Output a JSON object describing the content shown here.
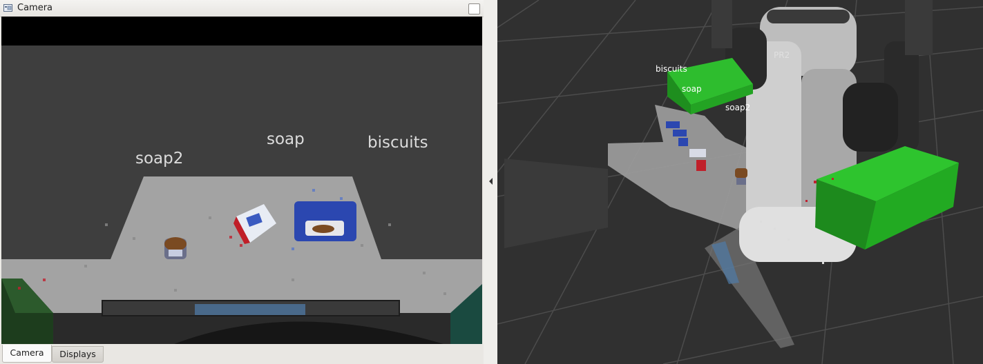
{
  "camera_panel": {
    "title": "Camera",
    "labels": {
      "soap2": "soap2",
      "soap": "soap",
      "biscuits": "biscuits"
    }
  },
  "tabs": {
    "camera": "Camera",
    "displays": "Displays"
  },
  "scene_view": {
    "robot_label": "PR2",
    "labels": {
      "biscuits": "biscuits",
      "soap": "soap",
      "soap2": "soap2"
    }
  },
  "colors": {
    "scene_background": "#303030",
    "grid": "#4a4a4a",
    "table": "#9a9a9a",
    "bin_green": "#2fbf2f",
    "soap_red": "#c0202a",
    "biscuits_blue": "#2b47b0"
  }
}
